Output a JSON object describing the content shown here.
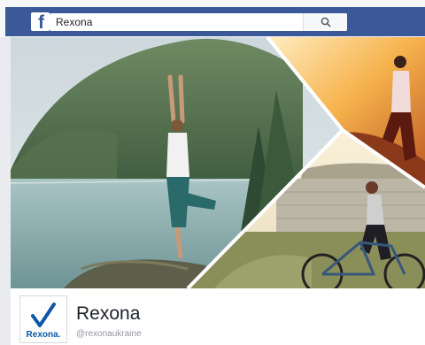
{
  "header": {
    "logo": "f",
    "search_value": "Rexona",
    "search_icon": "search-icon"
  },
  "cover": {
    "photos": [
      "yoga-pose-by-lake",
      "runner-at-sunset",
      "woman-riding-bicycle"
    ]
  },
  "page": {
    "name": "Rexona",
    "handle": "@rexonaukraine",
    "logo_text": "Rexona."
  },
  "colors": {
    "facebook_blue": "#3b5998",
    "rexona_blue": "#0f57a6"
  }
}
